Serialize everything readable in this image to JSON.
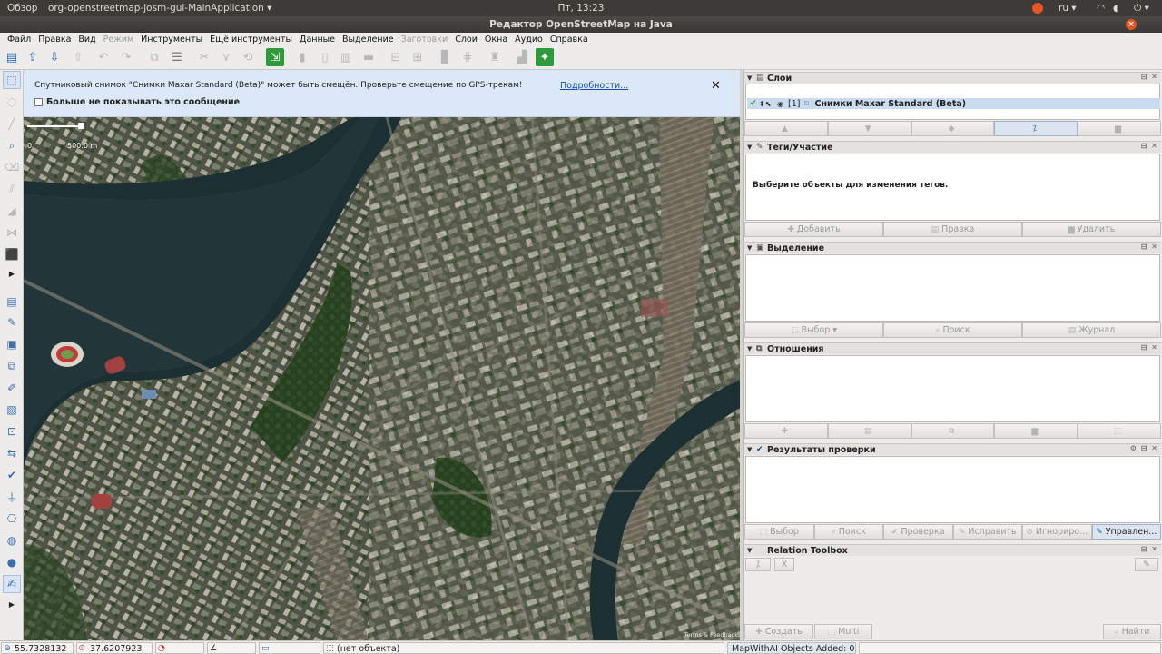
{
  "topbar": {
    "activities": "Обзор",
    "app_name": "org-openstreetmap-josm-gui-MainApplication ▾",
    "clock": "Пт, 13:23",
    "lang": "ru ▾",
    "wifi_icon": "wifi-icon",
    "volume_icon": "volume-icon",
    "power_icon": "power-icon"
  },
  "window": {
    "title": "Редактор OpenStreetMap на Java",
    "close": "×"
  },
  "menu": {
    "items": [
      {
        "label": "Файл",
        "enabled": true
      },
      {
        "label": "Правка",
        "enabled": true
      },
      {
        "label": "Вид",
        "enabled": true
      },
      {
        "label": "Режим",
        "enabled": false
      },
      {
        "label": "Инструменты",
        "enabled": true
      },
      {
        "label": "Ещё инструменты",
        "enabled": true
      },
      {
        "label": "Данные",
        "enabled": true
      },
      {
        "label": "Выделение",
        "enabled": true
      },
      {
        "label": "Заготовки",
        "enabled": false
      },
      {
        "label": "Слои",
        "enabled": true
      },
      {
        "label": "Окна",
        "enabled": true
      },
      {
        "label": "Аудио",
        "enabled": true
      },
      {
        "label": "Справка",
        "enabled": true
      }
    ]
  },
  "toolbar": {
    "icons": [
      {
        "name": "open-file-icon",
        "glyph": "▤",
        "state": "active"
      },
      {
        "name": "open-url-icon",
        "glyph": "⇪",
        "state": "active"
      },
      {
        "name": "download-icon",
        "glyph": "⇩",
        "state": "green-outline"
      },
      {
        "name": "upload-icon",
        "glyph": "⇧",
        "state": "dim"
      },
      {
        "name": "undo-icon",
        "glyph": "↶",
        "state": "dim"
      },
      {
        "name": "redo-icon",
        "glyph": "↷",
        "state": "dim"
      },
      {
        "name": "copy-icon",
        "glyph": "⧉",
        "state": "dim"
      },
      {
        "name": "preferences-icon",
        "glyph": "☰",
        "state": "normal"
      },
      {
        "name": "split-way-icon",
        "glyph": "✂",
        "state": "dim"
      },
      {
        "name": "combine-way-icon",
        "glyph": "⋎",
        "state": "dim"
      },
      {
        "name": "reverse-way-icon",
        "glyph": "⟲",
        "state": "dim"
      },
      {
        "name": "download-along-icon",
        "glyph": "⇲",
        "state": "green"
      },
      {
        "name": "align-line-icon",
        "glyph": "▮",
        "state": "dim"
      },
      {
        "name": "align-circle-icon",
        "glyph": "▯",
        "state": "dim"
      },
      {
        "name": "orthogonalize-icon",
        "glyph": "▥",
        "state": "dim"
      },
      {
        "name": "building-icon",
        "glyph": "▬",
        "state": "dim"
      },
      {
        "name": "bus-icon",
        "glyph": "⊟",
        "state": "dim"
      },
      {
        "name": "tram-icon",
        "glyph": "⊞",
        "state": "dim"
      },
      {
        "name": "barrier-icon",
        "glyph": "▊",
        "state": "dim"
      },
      {
        "name": "grid-icon",
        "glyph": "⋕",
        "state": "dim"
      },
      {
        "name": "castle-icon",
        "glyph": "♜",
        "state": "dim"
      },
      {
        "name": "chart-icon",
        "glyph": "▟",
        "state": "dim"
      },
      {
        "name": "mapwithai-icon",
        "glyph": "✦",
        "state": "green"
      }
    ]
  },
  "lefttools": {
    "icons": [
      {
        "name": "select-tool-icon",
        "glyph": "⬚",
        "state": "sel"
      },
      {
        "name": "lasso-tool-icon",
        "glyph": "◌",
        "state": "dim"
      },
      {
        "name": "draw-tool-icon",
        "glyph": "╱",
        "state": "dim"
      },
      {
        "name": "zoom-tool-icon",
        "glyph": "⌕",
        "state": "en"
      },
      {
        "name": "delete-tool-icon",
        "glyph": "⌫",
        "state": "dim"
      },
      {
        "name": "parallel-tool-icon",
        "glyph": "⫽",
        "state": "dim"
      },
      {
        "name": "extrude-tool-icon",
        "glyph": "◢",
        "state": "dim"
      },
      {
        "name": "improve-way-icon",
        "glyph": "⋈",
        "state": "dim"
      },
      {
        "name": "building-tool-icon",
        "glyph": "⬛",
        "state": "dim"
      },
      {
        "name": "expand-tools-arrow-icon",
        "glyph": "▶",
        "state": "arrow"
      },
      {
        "name": "layers-toggle-icon",
        "glyph": "▤",
        "state": "en"
      },
      {
        "name": "tags-toggle-icon",
        "glyph": "✎",
        "state": "en"
      },
      {
        "name": "selection-toggle-icon",
        "glyph": "▣",
        "state": "en"
      },
      {
        "name": "relations-toggle-icon",
        "glyph": "⧉",
        "state": "en"
      },
      {
        "name": "history-toggle-icon",
        "glyph": "✐",
        "state": "en"
      },
      {
        "name": "imagery-toggle-icon",
        "glyph": "▧",
        "state": "en"
      },
      {
        "name": "notes-toggle-icon",
        "glyph": "⊡",
        "state": "en"
      },
      {
        "name": "conflict-toggle-icon",
        "glyph": "⇆",
        "state": "en"
      },
      {
        "name": "validation-toggle-icon",
        "glyph": "✔",
        "state": "en"
      },
      {
        "name": "filter-toggle-icon",
        "glyph": "⏚",
        "state": "en"
      },
      {
        "name": "gift-toggle-icon",
        "glyph": "⎔",
        "state": "en"
      },
      {
        "name": "globe-toggle-icon",
        "glyph": "◍",
        "state": "en"
      },
      {
        "name": "map-pin-toggle-icon",
        "glyph": "●",
        "state": "en"
      },
      {
        "name": "toolbox-toggle-icon",
        "glyph": "✍",
        "state": "sel"
      },
      {
        "name": "expand-panels-arrow-icon",
        "glyph": "▶",
        "state": "arrow"
      }
    ]
  },
  "banner": {
    "message": "Спутниковый снимок \"Снимки Maxar Standard (Beta)\" может быть смещён. Проверьте смещение по GPS-трекам!",
    "link": "Подробности...",
    "close": "✕",
    "dont_show": "Больше не показывать это сообщение"
  },
  "map": {
    "scale_zero": "0",
    "scale_distance": "500.0 m",
    "attribution": "Terms & Feedback"
  },
  "panels": {
    "layers": {
      "title": "Слои",
      "layer": {
        "check": "✔",
        "pin": "⬍⬉",
        "eye": "◉",
        "index": "[1]",
        "name": "Снимки Maxar Standard (Beta)"
      },
      "buttons": [
        {
          "glyph": "▲",
          "label": "",
          "on": false
        },
        {
          "glyph": "▼",
          "label": "",
          "on": false
        },
        {
          "glyph": "◆",
          "label": "",
          "on": false
        },
        {
          "glyph": "⁒",
          "label": "",
          "on": true
        },
        {
          "glyph": "▆",
          "label": "",
          "on": false
        }
      ]
    },
    "tags": {
      "title": "Теги/Участие",
      "message": "Выберите объекты для изменения тегов.",
      "buttons": [
        {
          "glyph": "✚",
          "label": "Добавить",
          "on": false
        },
        {
          "glyph": "▤",
          "label": "Правка",
          "on": false
        },
        {
          "glyph": "▆",
          "label": "Удалить",
          "on": false
        }
      ]
    },
    "selection": {
      "title": "Выделение",
      "buttons": [
        {
          "glyph": "⬚",
          "label": "Выбор ▾",
          "on": false
        },
        {
          "glyph": "⌕",
          "label": "Поиск",
          "on": false
        },
        {
          "glyph": "▤",
          "label": "Журнал",
          "on": false
        }
      ]
    },
    "relations": {
      "title": "Отношения",
      "buttons": [
        {
          "glyph": "✚",
          "label": "",
          "on": false
        },
        {
          "glyph": "▤",
          "label": "",
          "on": false
        },
        {
          "glyph": "⧉",
          "label": "",
          "on": false
        },
        {
          "glyph": "▆",
          "label": "",
          "on": false
        },
        {
          "glyph": "⬚",
          "label": "",
          "on": false
        }
      ]
    },
    "validation": {
      "title": "Результаты проверки",
      "buttons": [
        {
          "glyph": "⬚",
          "label": "Выбор",
          "on": false
        },
        {
          "glyph": "⌕",
          "label": "Поиск",
          "on": false
        },
        {
          "glyph": "✔",
          "label": "Проверка",
          "on": false
        },
        {
          "glyph": "✎",
          "label": "Исправить",
          "on": false
        },
        {
          "glyph": "⊘",
          "label": "Игнориро...",
          "on": false
        },
        {
          "glyph": "✎",
          "label": "Управлен...",
          "on": true
        }
      ]
    },
    "relation_toolbox": {
      "title": "Relation Toolbox",
      "small_buttons": [
        "⁒",
        "X"
      ],
      "edit_glyph": "✎",
      "buttons": [
        {
          "glyph": "✚",
          "label": "Создать",
          "on": false
        },
        {
          "glyph": "⬚",
          "label": "Multi",
          "on": false
        },
        {
          "glyph": "⌕",
          "label": "Найти",
          "on": false
        }
      ]
    }
  },
  "statusbar": {
    "lat": "55.7328132",
    "lon": "37.6207923",
    "heading": "",
    "angle": "",
    "distance": "",
    "object": "(нет объекта)",
    "mapwithai": "MapWithAI Objects Added: 0"
  },
  "colors": {
    "accent": "#e95420",
    "selection": "#cbdcf0",
    "banner": "#dbe8f7"
  }
}
